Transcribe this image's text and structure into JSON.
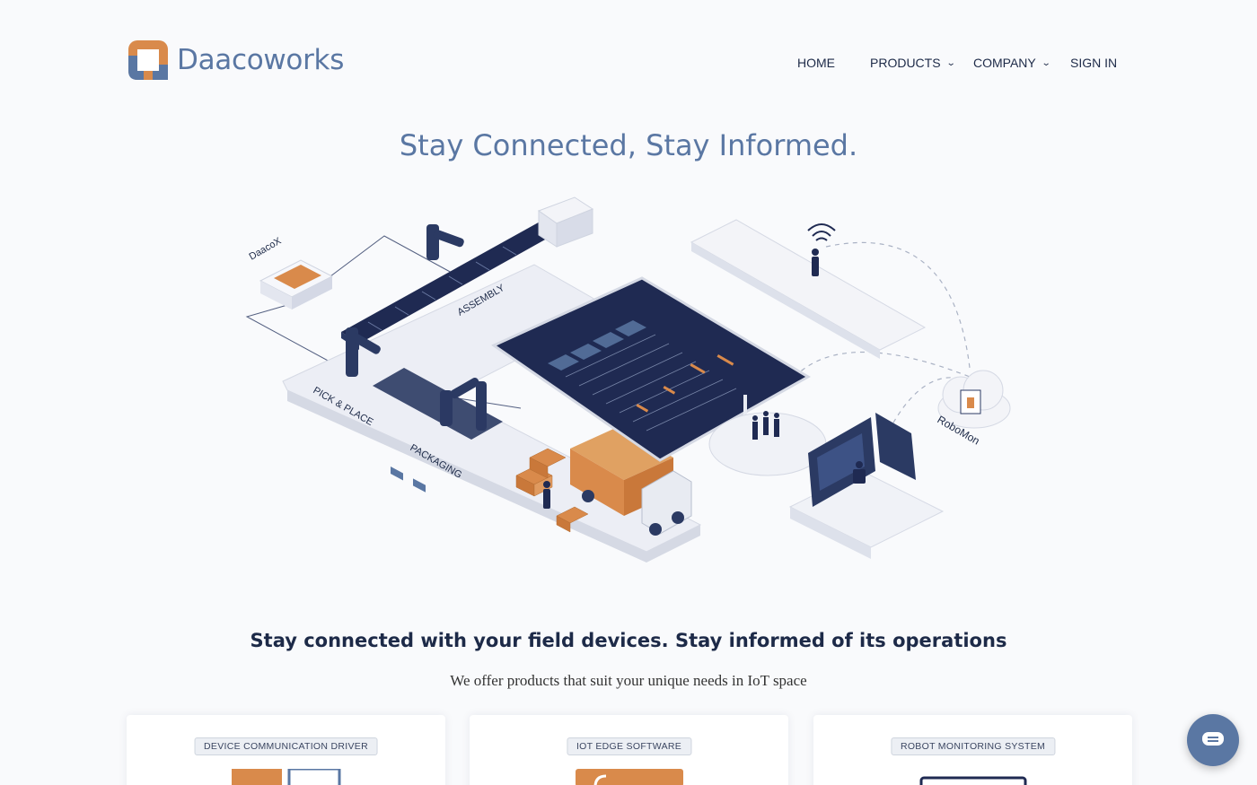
{
  "brand": {
    "name": "Daacoworks",
    "logo_colors": {
      "orange": "#d98a4b",
      "blue": "#5a77a3"
    }
  },
  "nav": {
    "home": "HOME",
    "products": "PRODUCTS",
    "company": "COMPANY",
    "sign_in": "SIGN IN"
  },
  "hero": {
    "title": "Stay Connected, Stay Informed."
  },
  "illustration": {
    "labels": {
      "daacox": "DaacoX",
      "assembly": "ASSEMBLY",
      "pick_place": "PICK & PLACE",
      "packaging": "PACKAGING",
      "robomon": "RoboMon"
    }
  },
  "section": {
    "title": "Stay connected with your field devices. Stay informed of its operations",
    "subtitle": "We offer products that suit your unique needs in IoT space"
  },
  "cards": [
    {
      "badge": "DEVICE COMMUNICATION DRIVER",
      "icon": "driver-icon"
    },
    {
      "badge": "IOT EDGE SOFTWARE",
      "icon": "edge-icon"
    },
    {
      "badge": "ROBOT MONITORING SYSTEM",
      "icon": "monitor-icon"
    }
  ],
  "chat": {
    "icon": "chat-icon",
    "color": "#5a77a3"
  }
}
